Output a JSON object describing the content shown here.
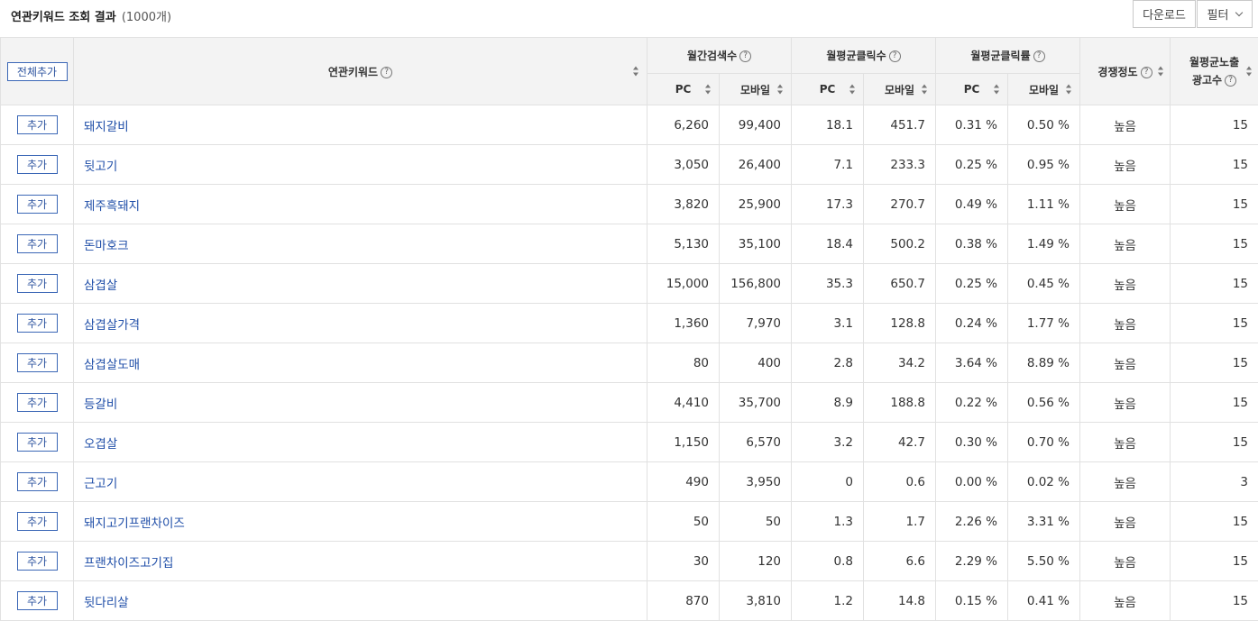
{
  "header": {
    "title": "연관키워드 조회 결과",
    "count": "(1000개)",
    "download_label": "다운로드",
    "filter_label": "필터"
  },
  "columns": {
    "add_all": "전체추가",
    "keyword": "연관키워드",
    "monthly_search": "월간검색수",
    "avg_clicks": "월평균클릭수",
    "avg_ctr": "월평균클릭률",
    "competition": "경쟁정도",
    "ad_count_line1": "월평균노출",
    "ad_count_line2": "광고수",
    "pc": "PC",
    "mobile": "모바일",
    "help_glyph": "?"
  },
  "row_button_label": "추가",
  "rows": [
    {
      "keyword": "돼지갈비",
      "search_pc": "6,260",
      "search_mobile": "99,400",
      "clicks_pc": "18.1",
      "clicks_mobile": "451.7",
      "ctr_pc": "0.31 %",
      "ctr_mobile": "0.50 %",
      "competition": "높음",
      "ads": "15"
    },
    {
      "keyword": "뒷고기",
      "search_pc": "3,050",
      "search_mobile": "26,400",
      "clicks_pc": "7.1",
      "clicks_mobile": "233.3",
      "ctr_pc": "0.25 %",
      "ctr_mobile": "0.95 %",
      "competition": "높음",
      "ads": "15"
    },
    {
      "keyword": "제주흑돼지",
      "search_pc": "3,820",
      "search_mobile": "25,900",
      "clicks_pc": "17.3",
      "clicks_mobile": "270.7",
      "ctr_pc": "0.49 %",
      "ctr_mobile": "1.11 %",
      "competition": "높음",
      "ads": "15"
    },
    {
      "keyword": "돈마호크",
      "search_pc": "5,130",
      "search_mobile": "35,100",
      "clicks_pc": "18.4",
      "clicks_mobile": "500.2",
      "ctr_pc": "0.38 %",
      "ctr_mobile": "1.49 %",
      "competition": "높음",
      "ads": "15"
    },
    {
      "keyword": "삼겹살",
      "search_pc": "15,000",
      "search_mobile": "156,800",
      "clicks_pc": "35.3",
      "clicks_mobile": "650.7",
      "ctr_pc": "0.25 %",
      "ctr_mobile": "0.45 %",
      "competition": "높음",
      "ads": "15"
    },
    {
      "keyword": "삼겹살가격",
      "search_pc": "1,360",
      "search_mobile": "7,970",
      "clicks_pc": "3.1",
      "clicks_mobile": "128.8",
      "ctr_pc": "0.24 %",
      "ctr_mobile": "1.77 %",
      "competition": "높음",
      "ads": "15"
    },
    {
      "keyword": "삼겹살도매",
      "search_pc": "80",
      "search_mobile": "400",
      "clicks_pc": "2.8",
      "clicks_mobile": "34.2",
      "ctr_pc": "3.64 %",
      "ctr_mobile": "8.89 %",
      "competition": "높음",
      "ads": "15"
    },
    {
      "keyword": "등갈비",
      "search_pc": "4,410",
      "search_mobile": "35,700",
      "clicks_pc": "8.9",
      "clicks_mobile": "188.8",
      "ctr_pc": "0.22 %",
      "ctr_mobile": "0.56 %",
      "competition": "높음",
      "ads": "15"
    },
    {
      "keyword": "오겹살",
      "search_pc": "1,150",
      "search_mobile": "6,570",
      "clicks_pc": "3.2",
      "clicks_mobile": "42.7",
      "ctr_pc": "0.30 %",
      "ctr_mobile": "0.70 %",
      "competition": "높음",
      "ads": "15"
    },
    {
      "keyword": "근고기",
      "search_pc": "490",
      "search_mobile": "3,950",
      "clicks_pc": "0",
      "clicks_mobile": "0.6",
      "ctr_pc": "0.00 %",
      "ctr_mobile": "0.02 %",
      "competition": "높음",
      "ads": "3"
    },
    {
      "keyword": "돼지고기프랜차이즈",
      "search_pc": "50",
      "search_mobile": "50",
      "clicks_pc": "1.3",
      "clicks_mobile": "1.7",
      "ctr_pc": "2.26 %",
      "ctr_mobile": "3.31 %",
      "competition": "높음",
      "ads": "15"
    },
    {
      "keyword": "프랜차이즈고기집",
      "search_pc": "30",
      "search_mobile": "120",
      "clicks_pc": "0.8",
      "clicks_mobile": "6.6",
      "ctr_pc": "2.29 %",
      "ctr_mobile": "5.50 %",
      "competition": "높음",
      "ads": "15"
    },
    {
      "keyword": "뒷다리살",
      "search_pc": "870",
      "search_mobile": "3,810",
      "clicks_pc": "1.2",
      "clicks_mobile": "14.8",
      "ctr_pc": "0.15 %",
      "ctr_mobile": "0.41 %",
      "competition": "높음",
      "ads": "15"
    }
  ]
}
